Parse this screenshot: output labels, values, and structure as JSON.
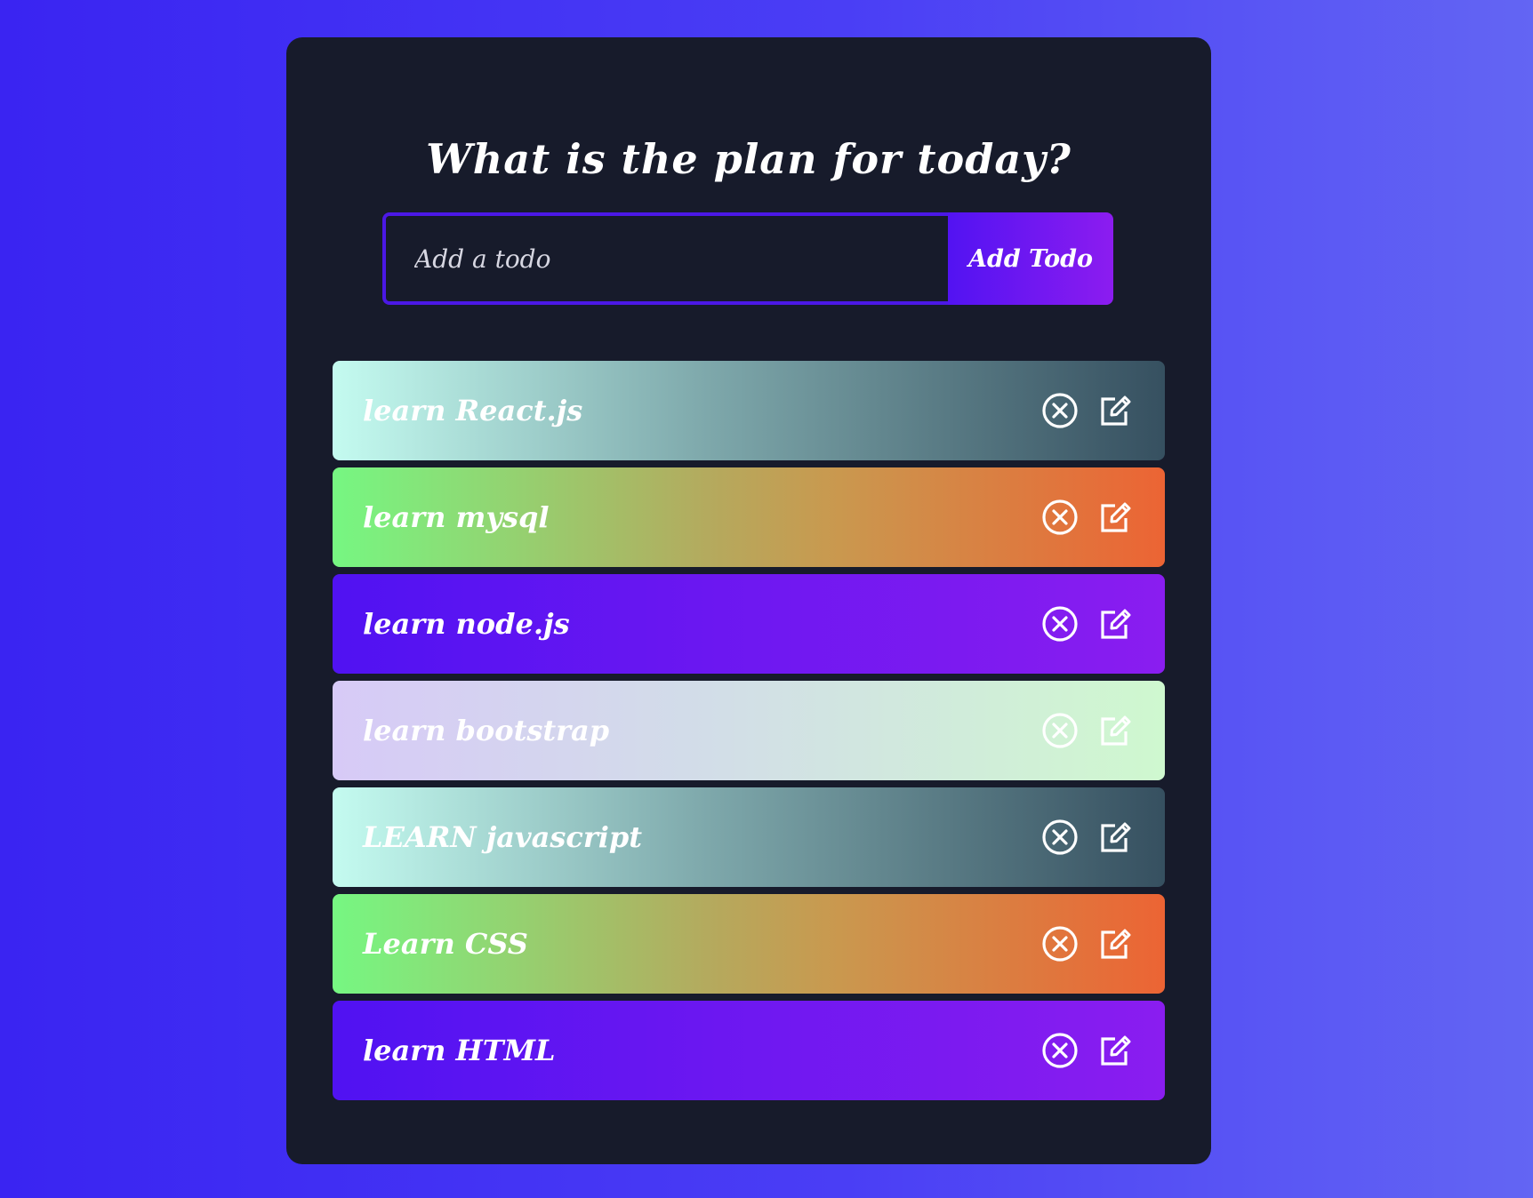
{
  "app": {
    "title": "What is the plan for today?"
  },
  "form": {
    "placeholder": "Add a todo",
    "button_label": "Add Todo"
  },
  "todos": [
    {
      "text": "learn React.js",
      "theme": "teal"
    },
    {
      "text": "learn mysql",
      "theme": "orange"
    },
    {
      "text": "learn node.js",
      "theme": "purple"
    },
    {
      "text": "learn bootstrap",
      "theme": "pastel"
    },
    {
      "text": "LEARN javascript",
      "theme": "teal"
    },
    {
      "text": "Learn CSS",
      "theme": "orange"
    },
    {
      "text": "learn HTML",
      "theme": "purple"
    }
  ],
  "icons": {
    "delete": "close-circle-icon",
    "edit": "edit-icon"
  },
  "colors": {
    "background_start": "#3a24f2",
    "background_end": "#6365f3",
    "panel": "#171b2b",
    "accent": "#4b18e6"
  }
}
